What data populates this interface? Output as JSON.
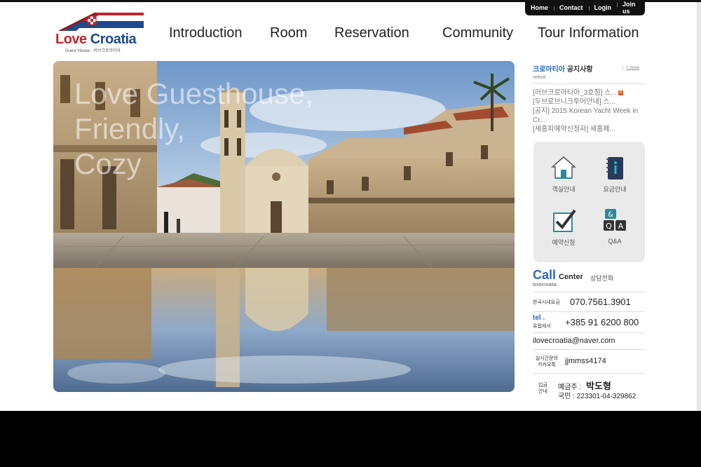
{
  "util_nav": [
    "Home",
    "Contact",
    "Login",
    "Join us"
  ],
  "logo": {
    "part1": "Love",
    "part2": "Croatia",
    "sub": "Guest House - 러브크로아티아"
  },
  "main_nav": [
    "Introduction",
    "Room",
    "Reservation",
    "Community",
    "Tour Information"
  ],
  "hero": {
    "caption_lines": [
      "Love Guesthouse,",
      "Friendly,",
      "Cozy"
    ]
  },
  "notice": {
    "title_hl": "크로아티아",
    "title_rest": " 공지사항",
    "sub": "notice",
    "more": "+ more",
    "items": [
      "[러브크로아티아_3호점] 스...",
      "[두브로브니크투어안내] 스...",
      "[공지] 2015 Korean Yacht Week in Cr...",
      "[새홈피예약신청자] 새홈페..."
    ],
    "new_badge": "N"
  },
  "quick_menu": [
    {
      "label": "객실안내",
      "icon": "house-icon"
    },
    {
      "label": "요금안내",
      "icon": "info-book-icon"
    },
    {
      "label": "예약신청",
      "icon": "checkmark-icon"
    },
    {
      "label": "Q&A",
      "icon": "qa-icon"
    }
  ],
  "call_center": {
    "big": "Call",
    "center": "Center",
    "ko": "상담전화",
    "sub": "lovecroatia",
    "domestic_label": "한국시내요금",
    "domestic_number": "070.7561.3901",
    "tel_label": "tel .",
    "tel_label2": "유럽에서",
    "europe_number": "+385 91 6200 800",
    "email": "ilovecroatia@naver.com",
    "kakao_label": "실시간문의 카카오톡",
    "kakao_id": "jjmmss4174",
    "bank_label": "입금 안내",
    "holder_label": "예금주 :",
    "holder_name": "박도형",
    "account": "국민 : 223301-04-329862"
  },
  "colors": {
    "brand_blue": "#2a6ab8",
    "brand_red": "#c0262d",
    "quick_bg": "#eaeaea"
  }
}
